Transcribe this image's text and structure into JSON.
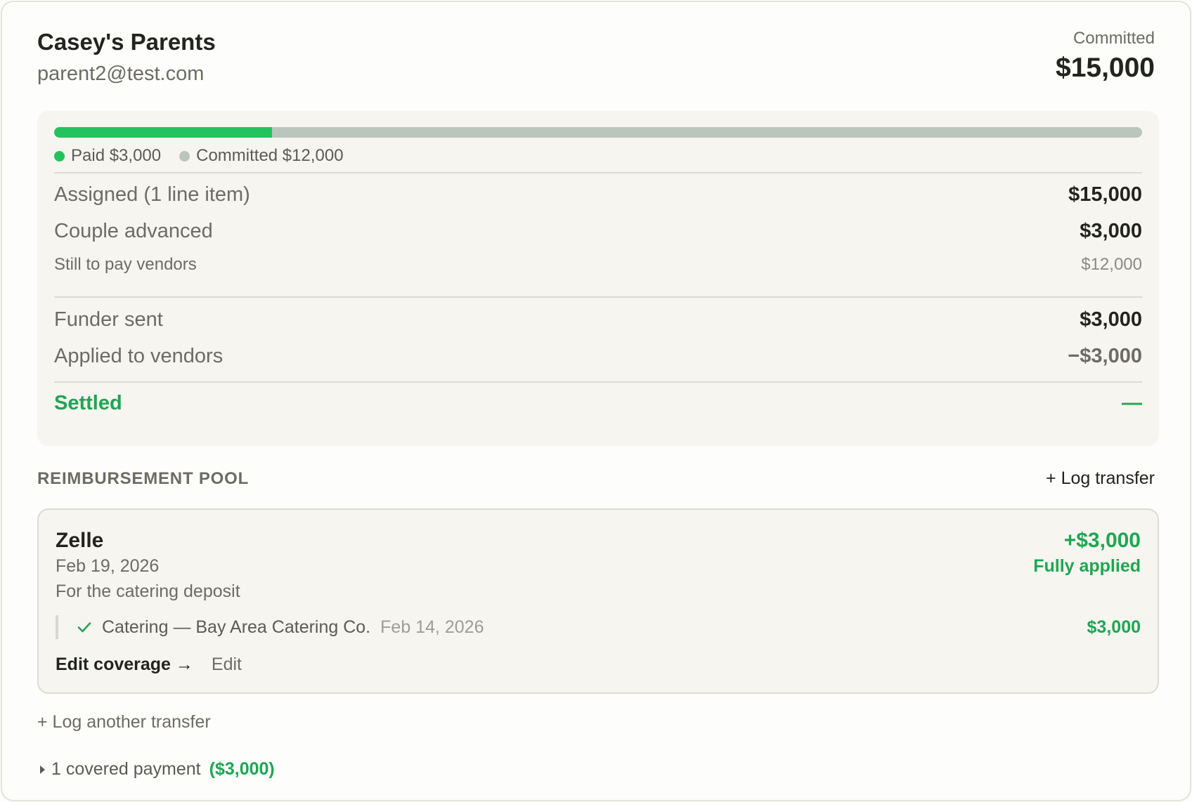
{
  "funder": {
    "name": "Casey's Parents",
    "email": "parent2@test.com",
    "committed_label": "Committed",
    "committed_value": "$15,000"
  },
  "progress": {
    "paid_fraction": 0.2,
    "paid_label": "Paid $3,000",
    "committed_label": "Committed $12,000",
    "colors": {
      "paid": "#22c35e",
      "committed": "#bac6bd"
    }
  },
  "summary": {
    "assigned_label": "Assigned (1 line item)",
    "assigned_value": "$15,000",
    "couple_advanced_label": "Couple advanced",
    "couple_advanced_value": "$3,000",
    "still_to_pay_label": "Still to pay vendors",
    "still_to_pay_value": "$12,000",
    "funder_sent_label": "Funder sent",
    "funder_sent_value": "$3,000",
    "applied_label": "Applied to vendors",
    "applied_value": "−$3,000",
    "settled_label": "Settled",
    "settled_value": "—"
  },
  "pool": {
    "title": "REIMBURSEMENT POOL",
    "log_transfer": "+ Log transfer",
    "transfer": {
      "method": "Zelle",
      "date": "Feb 19, 2026",
      "note": "For the catering deposit",
      "amount": "+$3,000",
      "status": "Fully applied",
      "coverage": {
        "icon": "check-icon",
        "text": "Catering — Bay Area Catering Co.",
        "date": "Feb 14, 2026",
        "amount": "$3,000"
      },
      "edit_coverage": "Edit coverage →",
      "edit": "Edit"
    },
    "log_another": "+ Log another transfer",
    "covered_payments": "1 covered payment",
    "covered_amount": "($3,000)"
  },
  "colors": {
    "accent_green": "#1ea653"
  }
}
